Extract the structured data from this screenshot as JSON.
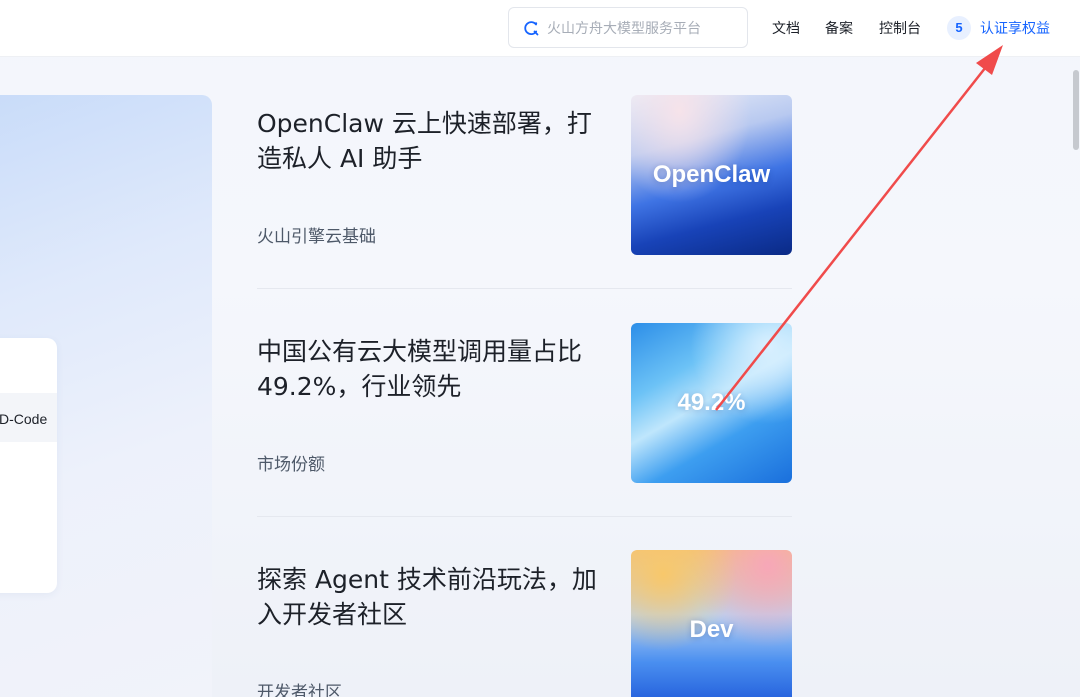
{
  "header": {
    "search": {
      "placeholder": "火山方舟大模型服务平台",
      "icon": "search-icon"
    },
    "nav": [
      {
        "label": "文档"
      },
      {
        "label": "备案"
      },
      {
        "label": "控制台"
      }
    ],
    "badge_count": "5",
    "cert_label": "认证享权益",
    "accent_color": "#1664ff"
  },
  "banner": {
    "card_label": "D-Code"
  },
  "articles": [
    {
      "title": "OpenClaw 云上快速部署，打造私人 AI 助手",
      "tag": "火山引擎云基础",
      "thumb_text": "OpenClaw"
    },
    {
      "title": "中国公有云大模型调用量占比49.2%，行业领先",
      "tag": "市场份额",
      "thumb_text": "49.2%"
    },
    {
      "title": "探索 Agent 技术前沿玩法，加入开发者社区",
      "tag": "开发者社区",
      "thumb_text": "Dev"
    }
  ],
  "annotation": {
    "color": "#f04b4b"
  }
}
